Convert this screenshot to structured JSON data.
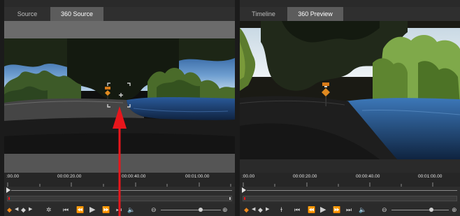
{
  "left_panel": {
    "tabs": [
      {
        "label": "Source",
        "active": false
      },
      {
        "label": "360 Source",
        "active": true
      }
    ],
    "timecodes": [
      ":00.00",
      "00:00:20.00",
      "00:00:40.00",
      "00:01:00.00"
    ]
  },
  "right_panel": {
    "tabs": [
      {
        "label": "Timeline",
        "active": false
      },
      {
        "label": "360 Preview",
        "active": true
      }
    ],
    "timecodes": [
      ":00.00",
      "00:00:20.00",
      "00:00:40.00",
      "00:01:00.00"
    ]
  },
  "colors": {
    "keyframe_accent": "#f08a1e",
    "annotation_arrow": "#e8161c",
    "active_tab": "#5c5c5c"
  },
  "icons": [
    "add-keyframe-icon",
    "prev-keyframe-icon",
    "keyframe-icon",
    "next-keyframe-icon",
    "settings-icon",
    "go-to-start-icon",
    "step-back-icon",
    "play-icon",
    "step-forward-icon",
    "go-to-end-icon",
    "volume-icon",
    "zoom-out-icon",
    "zoom-in-icon"
  ]
}
